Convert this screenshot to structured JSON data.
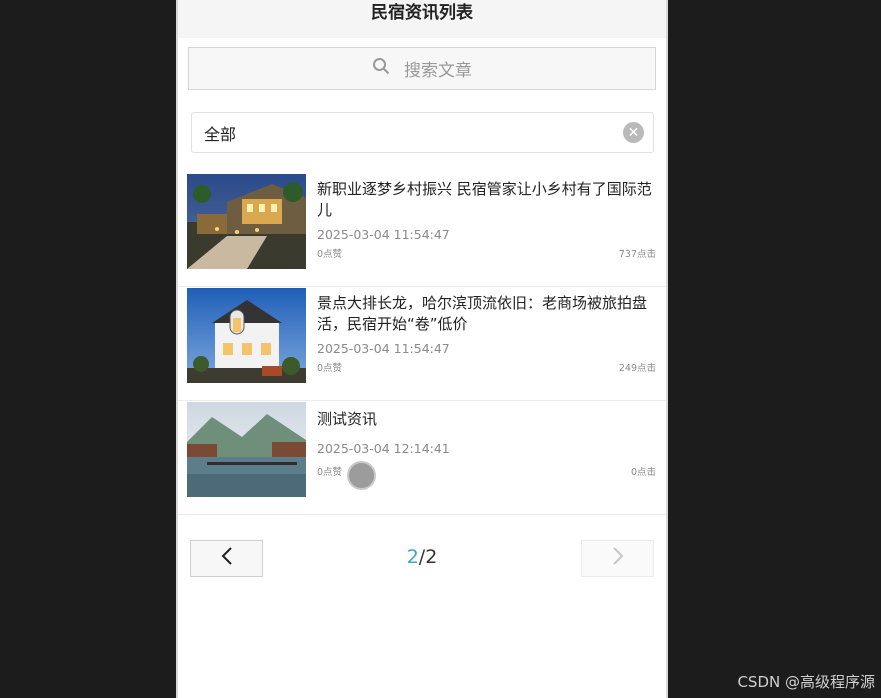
{
  "header": {
    "title": "民宿资讯列表"
  },
  "search": {
    "placeholder": "搜索文章",
    "icon": "search-icon"
  },
  "filter": {
    "value": "全部",
    "clear_icon": "clear-icon"
  },
  "articles": [
    {
      "title": "新职业逐梦乡村振兴 民宿管家让小乡村有了国际范儿",
      "date": "2025-03-04 11:54:47",
      "likes": "0点赞",
      "clicks": "737点击"
    },
    {
      "title": "景点大排长龙，哈尔滨顶流依旧：老商场被旅拍盘活，民宿开始“卷”低价",
      "date": "2025-03-04 11:54:47",
      "likes": "0点赞",
      "clicks": "249点击"
    },
    {
      "title": "测试资讯",
      "date": "2025-03-04 12:14:41",
      "likes": "0点赞",
      "clicks": "0点击"
    }
  ],
  "pager": {
    "current": "2",
    "separator": "/",
    "total": "2",
    "prev_icon": "chevron-left-icon",
    "next_icon": "chevron-right-icon"
  },
  "watermark": "CSDN @高级程序源",
  "colors": {
    "accent": "#3aa7c9",
    "background": "#1c1c1c"
  }
}
